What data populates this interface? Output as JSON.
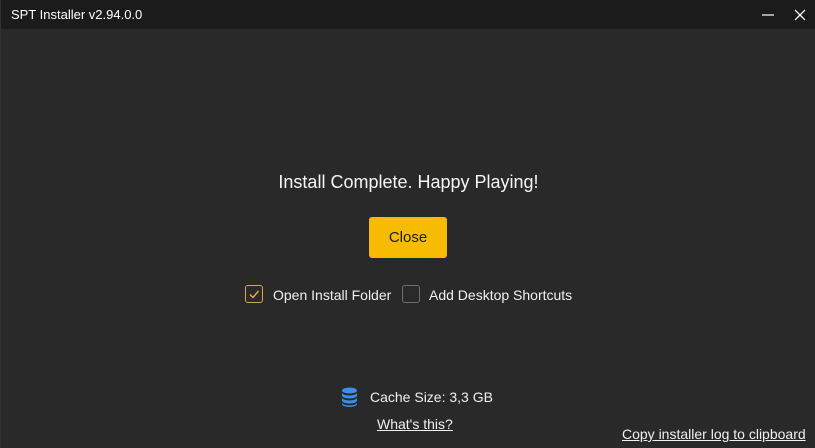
{
  "window": {
    "title": "SPT Installer v2.94.0.0"
  },
  "main": {
    "heading": "Install Complete. Happy Playing!",
    "close_label": "Close",
    "checkboxes": [
      {
        "label": "Open Install Folder",
        "checked": true
      },
      {
        "label": "Add Desktop Shortcuts",
        "checked": false
      }
    ]
  },
  "footer": {
    "cache_label": "Cache Size: 3,3 GB",
    "cache_icon": "database-icon",
    "whats_this": "What's this?",
    "copy_log": "Copy installer log to clipboard"
  },
  "colors": {
    "accent": "#f7bb00",
    "background": "#292929",
    "titlebar": "#1b1b1b",
    "cache_icon": "#3b8eea"
  }
}
